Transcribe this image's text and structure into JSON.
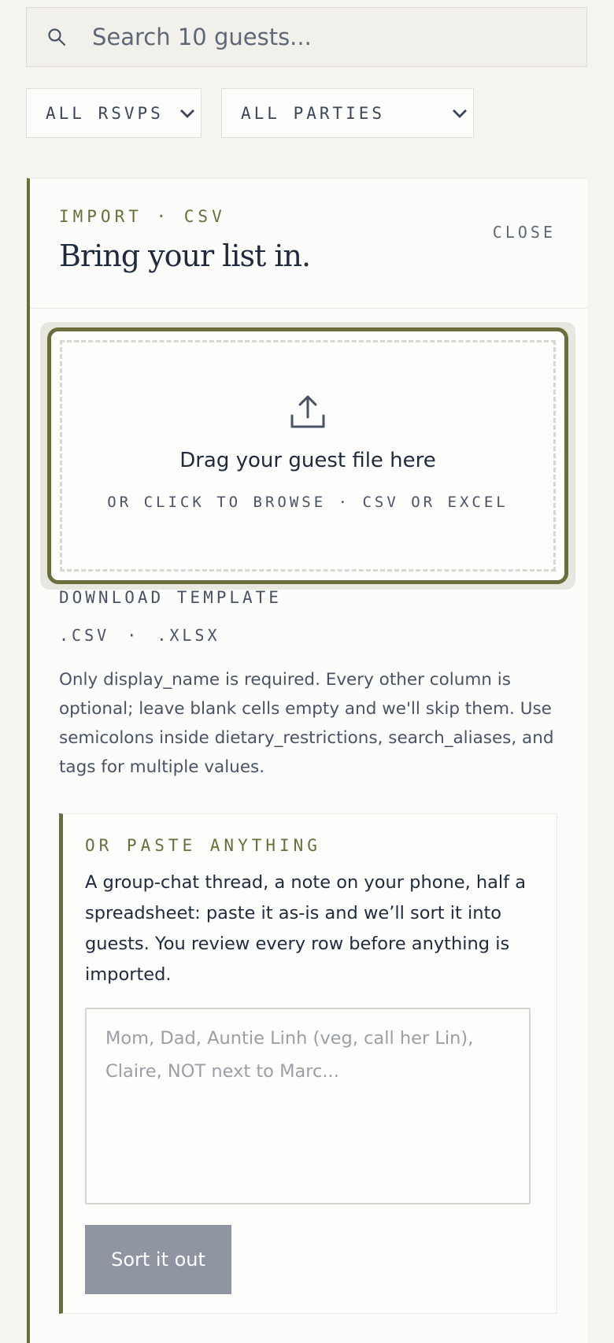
{
  "search": {
    "placeholder": "Search 10 guests...",
    "icon": "search-icon"
  },
  "filters": {
    "rsvp": {
      "selected": "ALL RSVPS"
    },
    "party": {
      "selected": "ALL PARTIES"
    }
  },
  "import_panel": {
    "eyebrow": "IMPORT · CSV",
    "title": "Bring your list in.",
    "close_label": "CLOSE",
    "dropzone": {
      "title": "Drag your guest file here",
      "subtitle": "OR CLICK TO BROWSE · CSV OR EXCEL",
      "icon": "upload-icon"
    },
    "download": {
      "title": "DOWNLOAD TEMPLATE",
      "csv_label": ".CSV",
      "separator": "·",
      "xlsx_label": ".XLSX"
    },
    "help_text": "Only display_name is required. Every other column is optional; leave blank cells empty and we'll skip them. Use semicolons inside dietary_restrictions, search_aliases, and tags for multiple values.",
    "paste": {
      "eyebrow": "OR PASTE ANYTHING",
      "description": "A group-chat thread, a note on your phone, half a spreadsheet: paste it as-is and we’ll sort it into guests. You review every row before anything is imported.",
      "placeholder": "Mom, Dad, Auntie Linh (veg, call her Lin), Claire, NOT next to Marc...",
      "button_label": "Sort it out"
    }
  },
  "colors": {
    "accent": "#6b6d3c",
    "background": "#f5f4ef",
    "text": "#1f2a3d",
    "muted": "#4a5365",
    "button_disabled": "#8f95a1"
  }
}
